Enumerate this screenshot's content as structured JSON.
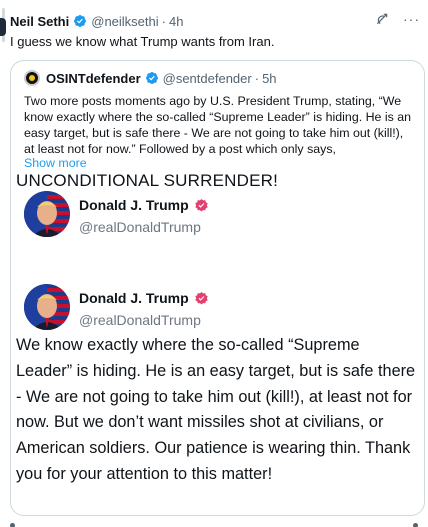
{
  "tweet": {
    "author_name": "Neil Sethi",
    "author_handle": "@neilksethi",
    "separator": "·",
    "time": "4h",
    "text": "I guess we know what Trump wants from Iran.",
    "more_label": "···"
  },
  "quote": {
    "author_name": "OSINTdefender",
    "author_handle": "@sentdefender",
    "separator": "·",
    "time": "5h",
    "text": "Two more posts moments ago by U.S. President Trump, stating, “We know exactly where the so-called “Supreme Leader” is hiding. He is an easy target, but is safe there - We are not going to take him out (kill!), at least not for now.” Followed by a post which only says,",
    "show_more": "Show more"
  },
  "truth_posts": [
    {
      "name": "Donald J. Trump",
      "handle": "@realDonaldTrump",
      "text": "UNCONDITIONAL SURRENDER!"
    },
    {
      "name": "Donald J. Trump",
      "handle": "@realDonaldTrump",
      "text": "We know exactly where the so-called “Supreme Leader” is hiding. He is an easy target, but is safe there - We are not going to take him out (kill!), at least not for now. But we don’t want missiles shot at civilians, or American soldiers. Our patience is wearing thin. Thank you for your attention to this matter!"
    }
  ],
  "icons": {
    "verified": "verified-badge-icon",
    "grok": "grok-icon",
    "more": "more-icon",
    "truth_verified": "truth-verified-icon"
  },
  "colors": {
    "accent": "#1d9bf0",
    "text": "#0f1419",
    "secondary": "#536471",
    "border": "#cfd9de",
    "truth_badge": "#e4406f"
  }
}
